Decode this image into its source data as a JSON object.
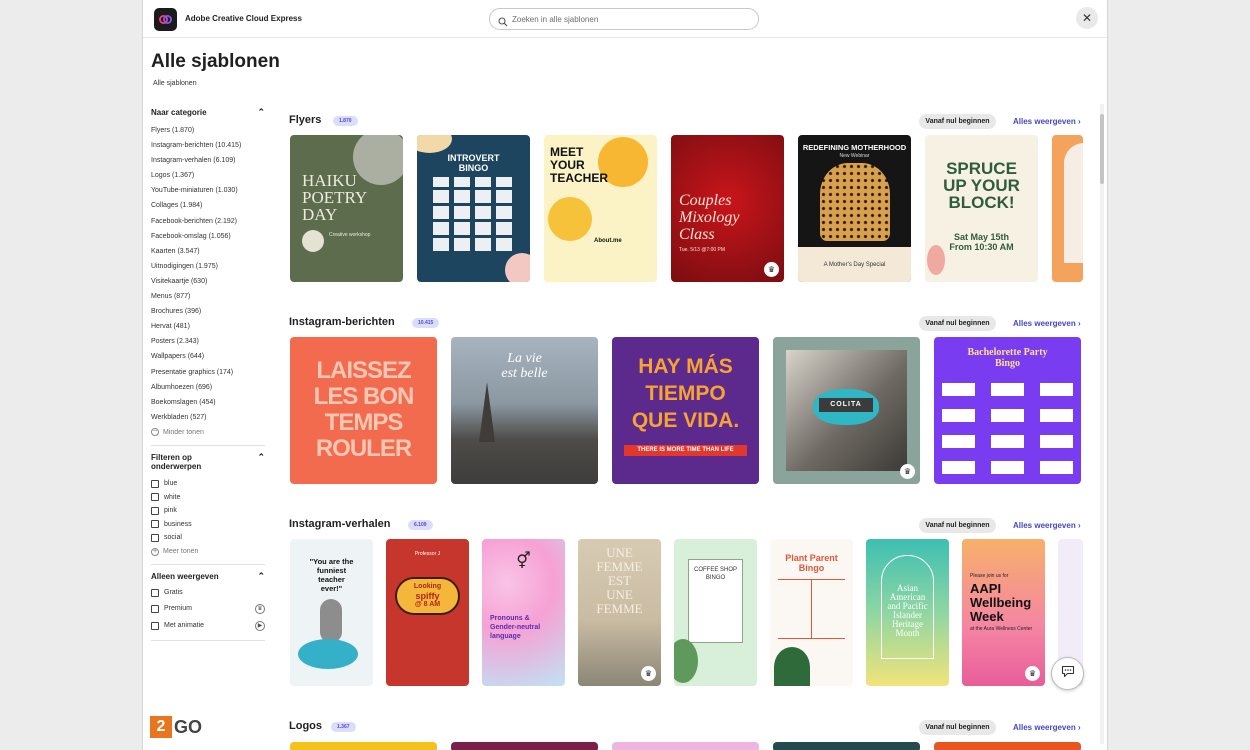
{
  "app": {
    "title": "Adobe Creative Cloud Express"
  },
  "search": {
    "placeholder": "Zoeken in alle sjablonen"
  },
  "page": {
    "title": "Alle sjablonen",
    "breadcrumb": "Alle sjablonen"
  },
  "sidebar": {
    "category_heading": "Naar categorie",
    "categories": [
      "Flyers (1.870)",
      "Instagram-berichten (10.415)",
      "Instagram-verhalen (6.109)",
      "Logos (1.367)",
      "YouTube-miniaturen (1.030)",
      "Collages (1.984)",
      "Facebook-berichten (2.192)",
      "Facebook-omslag (1.056)",
      "Kaarten (3.547)",
      "Uitnodigingen (1.975)",
      "Visitekaartje (630)",
      "Menus (877)",
      "Brochures (396)",
      "Hervat (481)",
      "Posters (2.343)",
      "Wallpapers (644)",
      "Presentatie graphics (174)",
      "Albumhoezen (696)",
      "Boekomslagen (454)",
      "Werkbladen (527)"
    ],
    "less_label": "Minder tonen",
    "topics_heading": "Filteren op onderwerpen",
    "topics": [
      "blue",
      "white",
      "pink",
      "business",
      "social"
    ],
    "more_label": "Meer tonen",
    "show_heading": "Alleen weergeven",
    "show_options": [
      "Gratis",
      "Premium",
      "Met animatie"
    ]
  },
  "sections": [
    {
      "title": "Flyers",
      "count": "1.870",
      "start_label": "Vanaf nul beginnen",
      "see_all": "Alles weergeven",
      "cards": [
        {
          "lines": [
            "Haiku",
            "Poetry",
            "Day",
            "Creative workshop"
          ],
          "premium": false
        },
        {
          "lines": [
            "INTROVERT",
            "BINGO"
          ],
          "premium": false
        },
        {
          "lines": [
            "MEET",
            "YOUR",
            "TEACHER",
            "About.me"
          ],
          "premium": false
        },
        {
          "lines": [
            "Couples",
            "Mixology",
            "Class",
            "Tue. 5/13 @7:00 PM"
          ],
          "premium": true
        },
        {
          "lines": [
            "REDEFINING MOTHERHOOD",
            "New Webinar",
            "A Mother's Day Special"
          ],
          "premium": false
        },
        {
          "lines": [
            "SPRUCE",
            "UP YOUR",
            "BLOCK!",
            "Sat May 15th",
            "From 10:30 AM"
          ],
          "premium": false
        },
        {
          "lines": [],
          "premium": false
        }
      ]
    },
    {
      "title": "Instagram-berichten",
      "count": "10.415",
      "start_label": "Vanaf nul beginnen",
      "see_all": "Alles weergeven",
      "cards": [
        {
          "lines": [
            "LAISSEZ",
            "LES BON",
            "TEMPS",
            "ROULER"
          ],
          "premium": false
        },
        {
          "lines": [
            "La vie",
            "est belle"
          ],
          "premium": false
        },
        {
          "lines": [
            "HAY MÁS",
            "TIEMPO",
            "QUE VIDA.",
            "THERE IS MORE TIME THAN LIFE"
          ],
          "premium": false
        },
        {
          "lines": [
            "COLITA"
          ],
          "premium": true
        },
        {
          "lines": [
            "Bachelorette Party",
            "Bingo"
          ],
          "premium": false
        }
      ]
    },
    {
      "title": "Instagram-verhalen",
      "count": "6.109",
      "start_label": "Vanaf nul beginnen",
      "see_all": "Alles weergeven",
      "cards": [
        {
          "lines": [
            "\"You are the",
            "funniest",
            "teacher",
            "ever!\""
          ],
          "premium": false
        },
        {
          "lines": [
            "Professor J",
            "Looking",
            "spiffy",
            "@ 8 AM"
          ],
          "premium": false
        },
        {
          "lines": [
            "Pronouns &",
            "Gender-neutral",
            "language"
          ],
          "premium": false
        },
        {
          "lines": [
            "UNE",
            "FEMME",
            "EST",
            "UNE",
            "FEMME"
          ],
          "premium": true
        },
        {
          "lines": [
            "COFFEE SHOP",
            "BINGO"
          ],
          "premium": false
        },
        {
          "lines": [
            "Plant Parent",
            "Bingo"
          ],
          "premium": false
        },
        {
          "lines": [
            "Asian",
            "American",
            "and Pacific",
            "Islander",
            "Heritage",
            "Month"
          ],
          "premium": false
        },
        {
          "lines": [
            "Please join us for",
            "AAPI",
            "Wellbeing",
            "Week",
            "at the Aura Wellness Center"
          ],
          "premium": true
        },
        {
          "lines": [],
          "premium": false
        }
      ]
    },
    {
      "title": "Logos",
      "count": "1.367",
      "start_label": "Vanaf nul beginnen",
      "see_all": "Alles weergeven",
      "cards": []
    }
  ],
  "watermark": {
    "num": "2",
    "text": "GO"
  }
}
